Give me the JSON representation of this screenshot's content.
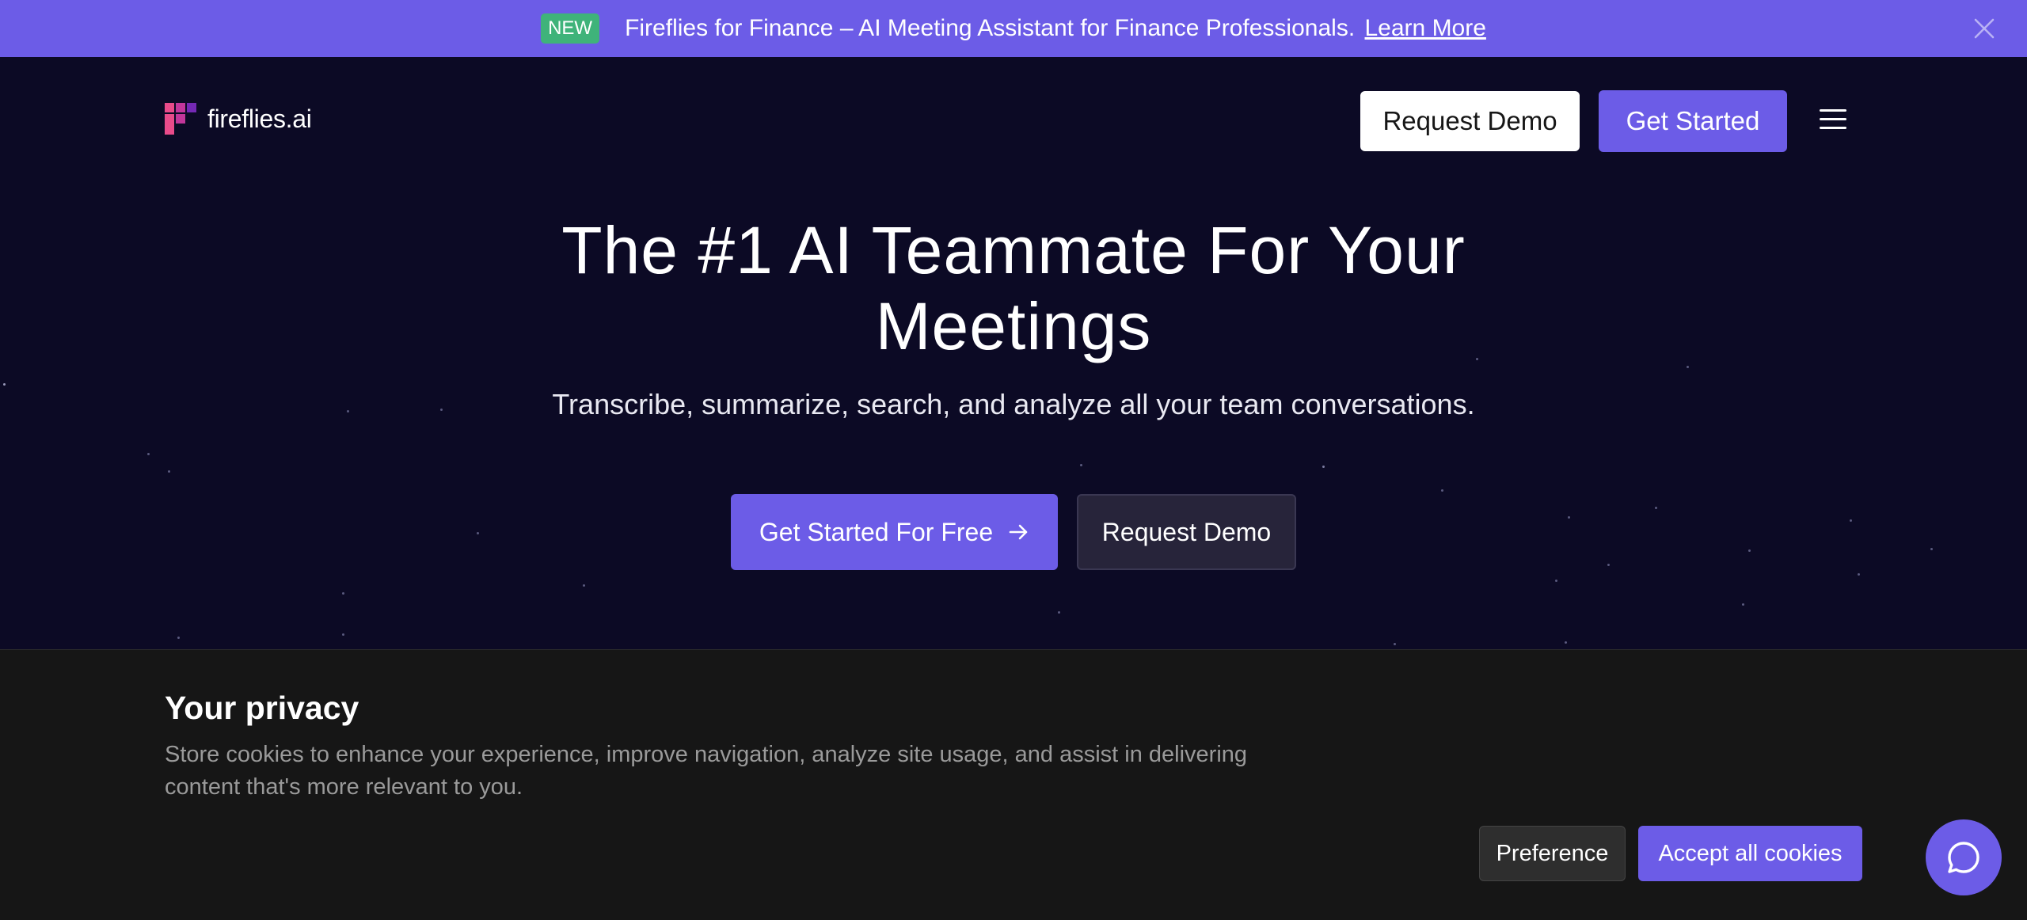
{
  "banner": {
    "badge": "NEW",
    "text": "Fireflies for Finance – AI Meeting Assistant for Finance Professionals.",
    "link": "Learn More"
  },
  "nav": {
    "logo_text": "fireflies.ai",
    "request_demo": "Request Demo",
    "get_started": "Get Started"
  },
  "hero": {
    "title_line1": "The #1 AI Teammate For Your",
    "title_line2": "Meetings",
    "subtitle": "Transcribe, summarize, search, and analyze all your team conversations.",
    "cta_primary": "Get Started For Free",
    "cta_secondary": "Request Demo"
  },
  "cookie": {
    "title": "Your privacy",
    "text": "Store cookies to enhance your experience, improve navigation, analyze site usage, and assist in delivering content that's more relevant to you.",
    "preference": "Preference",
    "accept": "Accept all cookies"
  },
  "colors": {
    "brand": "#6c5ce7",
    "hero_bg": "#0c0a25",
    "cookie_bg": "#161616",
    "badge": "#3fb37a"
  },
  "icons": {
    "close": "close-icon",
    "menu": "hamburger-menu-icon",
    "arrow": "arrow-right-icon",
    "chat": "chat-bubble-icon"
  }
}
